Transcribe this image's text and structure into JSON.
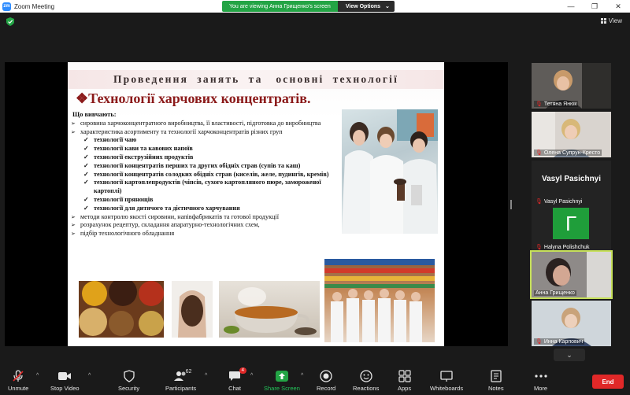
{
  "window": {
    "title": "Zoom Meeting",
    "app_icon_text": "zm",
    "buttons": [
      "minimize",
      "maximize",
      "close"
    ]
  },
  "share_banner": {
    "viewing_text": "You are viewing Анна Грищенко's screen",
    "view_options_label": "View Options"
  },
  "top_right": {
    "view_label": "View"
  },
  "slide": {
    "title": "Проведення  занять  та   основні  технології",
    "subtitle": "❖Технології харчових концентратів.",
    "lead": "Що вивчають:",
    "items": [
      {
        "level": 1,
        "text": "сировина харчоконцентратного виробництва, її властивості, підготовка до виробництва"
      },
      {
        "level": 1,
        "text": "характеристика асортименту та технології харчоконцентратів різних груп"
      },
      {
        "level": 2,
        "text": "технології чаю"
      },
      {
        "level": 2,
        "text": "технології кави та кавових напоїв"
      },
      {
        "level": 2,
        "text": "технології екструзійних продуктів"
      },
      {
        "level": 2,
        "text": "технології концентратів перших та других обідніх страв (супів та каш)"
      },
      {
        "level": 2,
        "text": "технології концентратів солодких обідніх страв (киселів, желе, пудингів, кремів)"
      },
      {
        "level": 2,
        "text": "технології картоплепродуктів (чіпсів, сухого картопляного пюре, замороженої картоплі)"
      },
      {
        "level": 2,
        "text": "технології прянощів"
      },
      {
        "level": 2,
        "text": "технології для дитячого та дієтичного харчування"
      },
      {
        "level": 1,
        "text": "методи контролю якості сировини, напівфабрикатів та готової продукції"
      },
      {
        "level": 1,
        "text": "розрахунок рецептур, складання апаратурно-технологічних схем,"
      },
      {
        "level": 1,
        "text": "підбір технологічного обладнання"
      }
    ]
  },
  "participants": [
    {
      "name": "Тетяна Янюк",
      "muted": true,
      "kind": "video"
    },
    {
      "name": "Олена Супрун-Кресто",
      "muted": true,
      "kind": "video"
    },
    {
      "name": "Vasyl Pasichnyi",
      "display": "Vasyl Pasichnyi",
      "muted": true,
      "kind": "name"
    },
    {
      "name": "Halyna Polishchuk",
      "initial": "Г",
      "muted": true,
      "kind": "avatar"
    },
    {
      "name": "Анна Грищенко",
      "muted": false,
      "kind": "video",
      "active": true
    },
    {
      "name": "Инна Карпович",
      "muted": true,
      "kind": "video"
    }
  ],
  "toolbar": {
    "unmute": "Unmute",
    "stop_video": "Stop Video",
    "security": "Security",
    "participants": "Participants",
    "participants_count": "62",
    "chat": "Chat",
    "chat_badge": "4",
    "share_screen": "Share Screen",
    "record": "Record",
    "reactions": "Reactions",
    "apps": "Apps",
    "whiteboards": "Whiteboards",
    "notes": "Notes",
    "more": "More",
    "end": "End"
  },
  "colors": {
    "banner_green": "#23a445",
    "end_red": "#e02828",
    "active_speaker": "#c6e05a",
    "slide_title_color": "#8b1a1a",
    "avatar_green": "#1f9e3a"
  }
}
